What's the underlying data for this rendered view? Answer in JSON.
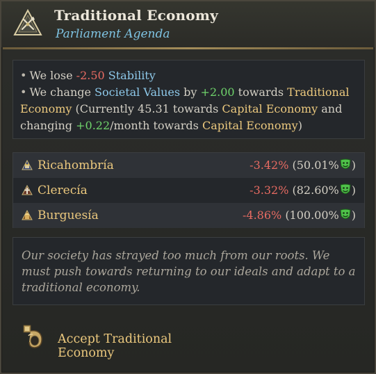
{
  "header": {
    "title": "Traditional Economy",
    "subtitle": "Parliament Agenda",
    "icon": "parliament-agenda-icon"
  },
  "effects": {
    "line1": {
      "prefix": "We lose ",
      "value": "-2.50",
      "stat": "Stability"
    },
    "line2": {
      "prefix": "We change ",
      "stat": "Societal Values",
      "by": " by ",
      "value": "+2.00",
      "towards": " towards ",
      "target": "Traditional Economy",
      "currently": " (Currently 45.31 towards ",
      "current_target": "Capital Economy",
      "and_changing": " and changing ",
      "rate": "+0.22",
      "per_month": "/month towards ",
      "rate_target": "Capital Economy",
      "close": ")"
    }
  },
  "parties": [
    {
      "name": "Ricahombría",
      "change": "-3.42%",
      "approval": "(50.01%",
      "close": ")",
      "icon": "estate-nobility-icon"
    },
    {
      "name": "Clerecía",
      "change": "-3.32%",
      "approval": "(82.60%",
      "close": ")",
      "icon": "estate-clergy-icon"
    },
    {
      "name": "Burguesía",
      "change": "-4.86%",
      "approval": "(100.00%",
      "close": ")",
      "icon": "estate-burghers-icon"
    }
  ],
  "flavor": "Our society has strayed too much from our roots. We must push towards returning to our ideals and adapt to a traditional economy.",
  "action": {
    "label": "Accept Traditional Economy",
    "icon": "accept-scroll-icon"
  },
  "colors": {
    "negative": "#e76b62",
    "positive": "#6fd36b",
    "highlight_blue": "#8ec9ea",
    "highlight_gold": "#ecc97e",
    "satisfied_mask": "#4fc24a"
  }
}
